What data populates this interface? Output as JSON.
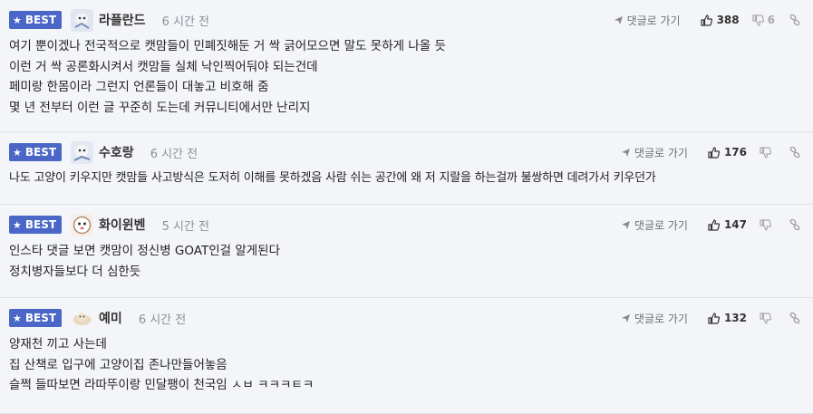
{
  "colors": {
    "best_badge": "#4a67c8",
    "background": "#f4f5f8"
  },
  "comments": [
    {
      "badge": "BEST",
      "nickname": "라플란드",
      "time": "6 시간 전",
      "reply_label": "댓글로 가기",
      "likes": "388",
      "dislikes": "6",
      "lines": [
        "여기 뿐이겠나 전국적으로 캣맘들이 민폐짓해둔 거 싹 긁어모으면 말도 못하게 나올 듯",
        "이런 거 싹 공론화시켜서 캣맘들 실체 낙인찍어둬야 되는건데",
        "페미랑 한몸이라 그런지 언론들이 대놓고 비호해 줌",
        "몇 년 전부터 이런 글 꾸준히 도는데 커뮤니티에서만 난리지"
      ]
    },
    {
      "badge": "BEST",
      "nickname": "수호랑",
      "time": "6 시간 전",
      "reply_label": "댓글로 가기",
      "likes": "176",
      "dislikes": "",
      "lines": [
        "나도 고양이 키우지만 캣맘들 사고방식은 도저히 이해를 못하겠음 사람 쉬는 공간에 왜 저 지랄을 하는걸까 불쌍하면 데려가서 키우던가"
      ]
    },
    {
      "badge": "BEST",
      "nickname": "화이윈벤",
      "time": "5 시간 전",
      "reply_label": "댓글로 가기",
      "likes": "147",
      "dislikes": "",
      "lines": [
        "인스타 댓글 보면 캣맘이 정신병 GOAT인걸 알게된다",
        "정치병자들보다 더 심한듯"
      ]
    },
    {
      "badge": "BEST",
      "nickname": "예미",
      "time": "6 시간 전",
      "reply_label": "댓글로 가기",
      "likes": "132",
      "dislikes": "",
      "lines": [
        "양재천 끼고 사는데",
        "집 산책로 입구에 고양이집 존나만들어놓음",
        "슬쩍 들따보면 라따뚜이랑 민달팽이 천국임 ㅅㅂ ㅋㅋㅋㅌㅋ"
      ]
    }
  ]
}
